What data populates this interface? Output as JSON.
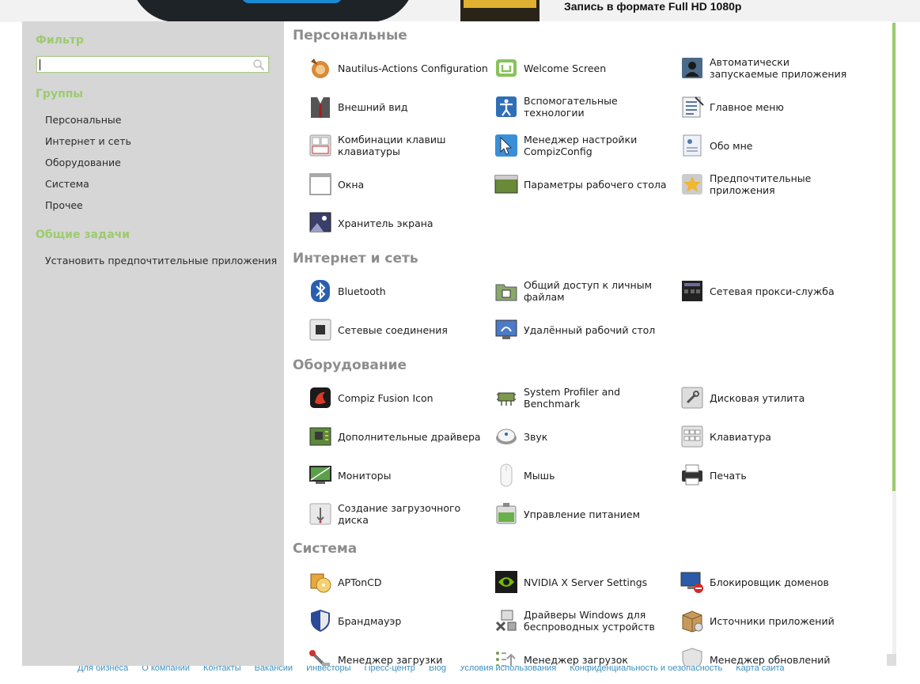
{
  "background_page": {
    "headline": "Запись в формате Full HD 1080p",
    "footer_links": [
      "Для бизнеса",
      "О компании",
      "Контакты",
      "Вакансии",
      "Инвесторы",
      "Пресс-центр",
      "Blog",
      "Условия использования",
      "Конфиденциальность и безопасность",
      "Карта сайта"
    ]
  },
  "sidebar": {
    "filter_heading": "Фильтр",
    "filter_value": "",
    "groups_heading": "Группы",
    "groups": [
      "Персональные",
      "Интернет и сеть",
      "Оборудование",
      "Система",
      "Прочее"
    ],
    "tasks_heading": "Общие задачи",
    "tasks": [
      "Установить предпочтительные приложения"
    ]
  },
  "sections": [
    {
      "title": "Персональные",
      "items": [
        {
          "label": "Nautilus-Actions Configuration",
          "icon": "nautilus-actions-icon"
        },
        {
          "label": "Welcome Screen",
          "icon": "mint-logo-icon"
        },
        {
          "label": "Автоматически запускаемые приложения",
          "icon": "startup-apps-icon"
        },
        {
          "label": "Внешний вид",
          "icon": "appearance-icon"
        },
        {
          "label": "Вспомогательные технологии",
          "icon": "accessibility-icon"
        },
        {
          "label": "Главное меню",
          "icon": "main-menu-icon"
        },
        {
          "label": "Комбинации клавиш клавиатуры",
          "icon": "keyboard-shortcuts-icon"
        },
        {
          "label": "Менеджер настройки CompizConfig",
          "icon": "compizconfig-icon"
        },
        {
          "label": "Обо мне",
          "icon": "about-me-icon"
        },
        {
          "label": "Окна",
          "icon": "windows-icon"
        },
        {
          "label": "Параметры рабочего стола",
          "icon": "desktop-settings-icon"
        },
        {
          "label": "Предпочтительные приложения",
          "icon": "preferred-apps-icon"
        },
        {
          "label": "Хранитель экрана",
          "icon": "screensaver-icon"
        }
      ]
    },
    {
      "title": "Интернет и сеть",
      "items": [
        {
          "label": "Bluetooth",
          "icon": "bluetooth-icon"
        },
        {
          "label": "Общий доступ к личным файлам",
          "icon": "file-sharing-icon"
        },
        {
          "label": "Сетевая прокси-служба",
          "icon": "network-proxy-icon"
        },
        {
          "label": "Сетевые соединения",
          "icon": "network-connections-icon"
        },
        {
          "label": "Удалённый рабочий стол",
          "icon": "remote-desktop-icon"
        }
      ]
    },
    {
      "title": "Оборудование",
      "items": [
        {
          "label": "Compiz Fusion Icon",
          "icon": "compiz-fusion-icon"
        },
        {
          "label": "System Profiler and Benchmark",
          "icon": "system-profiler-icon"
        },
        {
          "label": "Дисковая утилита",
          "icon": "disk-utility-icon"
        },
        {
          "label": "Дополнительные драйвера",
          "icon": "additional-drivers-icon"
        },
        {
          "label": "Звук",
          "icon": "sound-icon"
        },
        {
          "label": "Клавиатура",
          "icon": "keyboard-icon"
        },
        {
          "label": "Мониторы",
          "icon": "monitors-icon"
        },
        {
          "label": "Мышь",
          "icon": "mouse-icon"
        },
        {
          "label": "Печать",
          "icon": "printer-icon"
        },
        {
          "label": "Создание загрузочного диска",
          "icon": "startup-disk-icon"
        },
        {
          "label": "Управление питанием",
          "icon": "power-management-icon"
        }
      ]
    },
    {
      "title": "Система",
      "items": [
        {
          "label": "APTonCD",
          "icon": "aptoncd-icon"
        },
        {
          "label": "NVIDIA X Server Settings",
          "icon": "nvidia-icon"
        },
        {
          "label": "Блокировщик доменов",
          "icon": "domain-blocker-icon"
        },
        {
          "label": "Брандмауэр",
          "icon": "firewall-icon"
        },
        {
          "label": "Драйверы Windows для беспроводных устройств",
          "icon": "windows-wireless-drivers-icon"
        },
        {
          "label": "Источники приложений",
          "icon": "software-sources-icon"
        },
        {
          "label": "Менеджер загрузки",
          "icon": "boot-manager-icon"
        },
        {
          "label": "Менеджер загрузок",
          "icon": "download-manager-icon"
        },
        {
          "label": "Менеджер обновлений",
          "icon": "update-manager-icon"
        }
      ]
    }
  ]
}
